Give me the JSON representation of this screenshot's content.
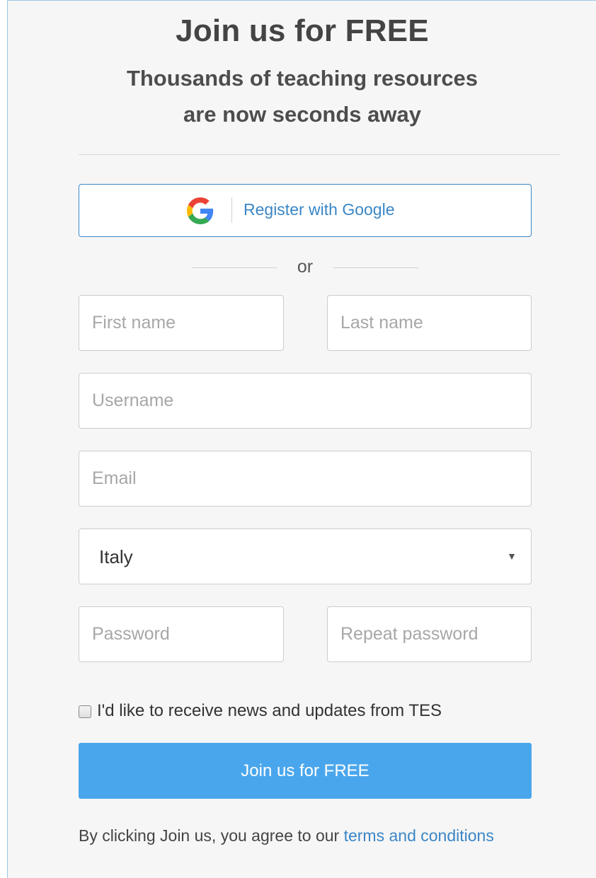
{
  "header": {
    "title": "Join us for FREE",
    "subtitle_line1": "Thousands of teaching resources",
    "subtitle_line2": "are now seconds away"
  },
  "google": {
    "label": "Register with Google",
    "icon": "google-g-icon",
    "border_color": "#3b89c9",
    "label_color": "#3a86c6"
  },
  "separator": {
    "text": "or"
  },
  "form": {
    "first_name": {
      "value": "",
      "placeholder": "First name"
    },
    "last_name": {
      "value": "",
      "placeholder": "Last name"
    },
    "username": {
      "value": "",
      "placeholder": "Username"
    },
    "email": {
      "value": "",
      "placeholder": "Email"
    },
    "country": {
      "selected": "Italy",
      "arrow": "▼"
    },
    "password": {
      "value": "",
      "placeholder": "Password"
    },
    "repeat_password": {
      "value": "",
      "placeholder": "Repeat password"
    }
  },
  "newsletter": {
    "label": "I'd like to receive news and updates from TES",
    "checked": false
  },
  "submit": {
    "label": "Join us for FREE",
    "color": "#4aa6ec"
  },
  "terms": {
    "prefix": "By clicking Join us, you agree to our ",
    "link_text": "terms and conditions",
    "link_color": "#3a86c6"
  }
}
